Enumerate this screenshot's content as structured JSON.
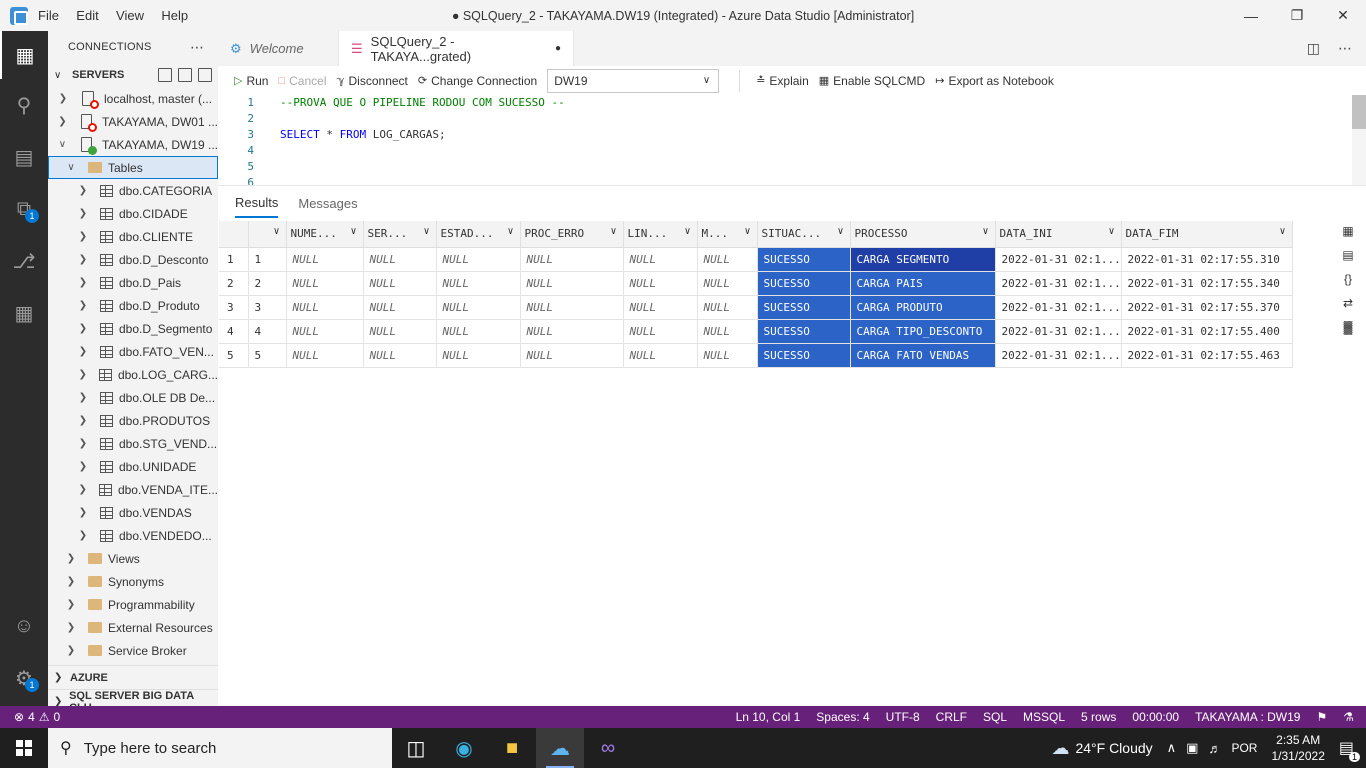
{
  "window": {
    "title": "● SQLQuery_2 - TAKAYAMA.DW19 (Integrated) - Azure Data Studio [Administrator]",
    "menu": [
      "File",
      "Edit",
      "View",
      "Help"
    ]
  },
  "activity_bar": {
    "extensions_badge": "1",
    "manage_badge": "1"
  },
  "sidebar": {
    "title": "CONNECTIONS",
    "servers_label": "SERVERS",
    "servers": [
      {
        "label": "localhost, master (...",
        "status_color": "#e51400"
      },
      {
        "label": "TAKAYAMA, DW01 ...",
        "status_color": "#e51400"
      },
      {
        "label": "TAKAYAMA, DW19 ...",
        "status_color": "#3ca53c"
      }
    ],
    "tables_label": "Tables",
    "tables": [
      "dbo.CATEGORIA",
      "dbo.CIDADE",
      "dbo.CLIENTE",
      "dbo.D_Desconto",
      "dbo.D_Pais",
      "dbo.D_Produto",
      "dbo.D_Segmento",
      "dbo.FATO_VEN...",
      "dbo.LOG_CARG...",
      "dbo.OLE DB De...",
      "dbo.PRODUTOS",
      "dbo.STG_VEND...",
      "dbo.UNIDADE",
      "dbo.VENDA_ITE...",
      "dbo.VENDAS",
      "dbo.VENDEDO..."
    ],
    "folders": [
      "Views",
      "Synonyms",
      "Programmability",
      "External Resources",
      "Service Broker"
    ],
    "azure_label": "AZURE",
    "bigdata_label": "SQL SERVER BIG DATA CLU..."
  },
  "tabs": [
    {
      "label": "Welcome"
    },
    {
      "label": "SQLQuery_2 - TAKAYA...grated)"
    }
  ],
  "toolbar": {
    "run": "Run",
    "cancel": "Cancel",
    "disconnect": "Disconnect",
    "change_connection": "Change Connection",
    "database": "DW19",
    "explain": "Explain",
    "sqlcmd": "Enable SQLCMD",
    "export": "Export as Notebook"
  },
  "editor": {
    "lines": [
      {
        "n": "1",
        "comment": "--PROVA QUE O PIPELINE RODOU COM SUCESSO --"
      },
      {
        "n": "2"
      },
      {
        "n": "3",
        "kw1": "SELECT",
        "mid": " * ",
        "kw2": "FROM",
        "rest": " LOG_CARGAS;"
      },
      {
        "n": "4"
      },
      {
        "n": "5"
      },
      {
        "n": "6"
      }
    ]
  },
  "results": {
    "tabs": [
      "Results",
      "Messages"
    ],
    "columns": [
      "NUME...",
      "SER...",
      "ESTAD...",
      "PROC_ERRO",
      "LIN...",
      "M...",
      "SITUAC...",
      "PROCESSO",
      "DATA_INI",
      "DATA_FIM"
    ],
    "rows": [
      [
        "1",
        "1",
        "NULL",
        "NULL",
        "NULL",
        "NULL",
        "NULL",
        "NULL",
        "SUCESSO",
        "CARGA SEGMENTO",
        "2022-01-31 02:1...",
        "2022-01-31 02:17:55.310"
      ],
      [
        "2",
        "2",
        "NULL",
        "NULL",
        "NULL",
        "NULL",
        "NULL",
        "NULL",
        "SUCESSO",
        "CARGA PAIS",
        "2022-01-31 02:1...",
        "2022-01-31 02:17:55.340"
      ],
      [
        "3",
        "3",
        "NULL",
        "NULL",
        "NULL",
        "NULL",
        "NULL",
        "NULL",
        "SUCESSO",
        "CARGA PRODUTO",
        "2022-01-31 02:1...",
        "2022-01-31 02:17:55.370"
      ],
      [
        "4",
        "4",
        "NULL",
        "NULL",
        "NULL",
        "NULL",
        "NULL",
        "NULL",
        "SUCESSO",
        "CARGA TIPO_DESCONTO",
        "2022-01-31 02:1...",
        "2022-01-31 02:17:55.400"
      ],
      [
        "5",
        "5",
        "NULL",
        "NULL",
        "NULL",
        "NULL",
        "NULL",
        "NULL",
        "SUCESSO",
        "CARGA FATO VENDAS",
        "2022-01-31 02:1...",
        "2022-01-31 02:17:55.463"
      ]
    ],
    "selection_color": "#2b63c7"
  },
  "status": {
    "errors": "4",
    "warnings": "0",
    "position": "Ln 10, Col 1",
    "spaces": "Spaces: 4",
    "encoding": "UTF-8",
    "eol": "CRLF",
    "language": "SQL",
    "provider": "MSSQL",
    "rows": "5 rows",
    "elapsed": "00:00:00",
    "connection": "TAKAYAMA : DW19",
    "color": "#68217a"
  },
  "taskbar": {
    "search_placeholder": "Type here to search",
    "weather": "24°F  Cloudy",
    "lang": "POR",
    "time": "2:35 AM",
    "date": "1/31/2022",
    "notification_count": "1"
  }
}
